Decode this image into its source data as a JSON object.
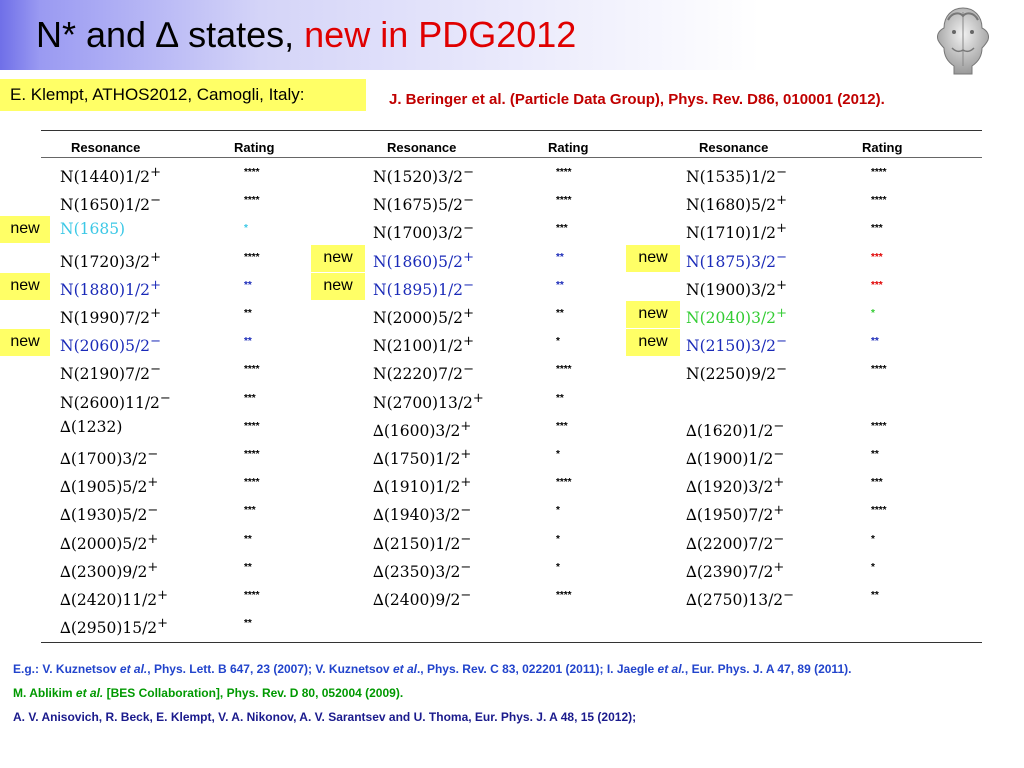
{
  "header": {
    "title_main": "N* and ∆ states, ",
    "title_highlight": "new in PDG2012"
  },
  "author_box": "E. Klempt, ATHOS2012, Camogli, Italy:",
  "top_reference": "J. Beringer et al. (Particle Data Group), Phys. Rev. D86, 010001 (2012).",
  "table": {
    "headers": {
      "resonance": "Resonance",
      "rating": "Rating"
    },
    "new_label": "new",
    "columns": [
      [
        {
          "base": "N(1440)1/2",
          "parity": "+",
          "rating": "****",
          "color": "black",
          "new": false
        },
        {
          "base": "N(1650)1/2",
          "parity": "−",
          "rating": "****",
          "color": "black",
          "new": false
        },
        {
          "base": "N(1685)",
          "parity": "",
          "rating": "*",
          "color": "cyan",
          "new": true
        },
        {
          "base": "N(1720)3/2",
          "parity": "+",
          "rating": "****",
          "color": "black",
          "new": false
        },
        {
          "base": "N(1880)1/2",
          "parity": "+",
          "rating": "**",
          "color": "blue",
          "new": true
        },
        {
          "base": "N(1990)7/2",
          "parity": "+",
          "rating": "**",
          "color": "black",
          "new": false
        },
        {
          "base": "N(2060)5/2",
          "parity": "−",
          "rating": "**",
          "color": "blue",
          "new": true
        },
        {
          "base": "N(2190)7/2",
          "parity": "−",
          "rating": "****",
          "color": "black",
          "new": false
        },
        {
          "base": "N(2600)11/2",
          "parity": "−",
          "rating": "***",
          "color": "black",
          "new": false
        },
        {
          "base": "∆(1232)",
          "parity": "",
          "rating": "****",
          "color": "black",
          "new": false
        },
        {
          "base": "∆(1700)3/2",
          "parity": "−",
          "rating": "****",
          "color": "black",
          "new": false
        },
        {
          "base": "∆(1905)5/2",
          "parity": "+",
          "rating": "****",
          "color": "black",
          "new": false
        },
        {
          "base": "∆(1930)5/2",
          "parity": "−",
          "rating": "***",
          "color": "black",
          "new": false
        },
        {
          "base": "∆(2000)5/2",
          "parity": "+",
          "rating": "**",
          "color": "black",
          "new": false
        },
        {
          "base": "∆(2300)9/2",
          "parity": "+",
          "rating": "**",
          "color": "black",
          "new": false
        },
        {
          "base": "∆(2420)11/2",
          "parity": "+",
          "rating": "****",
          "color": "black",
          "new": false
        },
        {
          "base": "∆(2950)15/2",
          "parity": "+",
          "rating": "**",
          "color": "black",
          "new": false
        }
      ],
      [
        {
          "base": "N(1520)3/2",
          "parity": "−",
          "rating": "****",
          "color": "black",
          "new": false
        },
        {
          "base": "N(1675)5/2",
          "parity": "−",
          "rating": "****",
          "color": "black",
          "new": false
        },
        {
          "base": "N(1700)3/2",
          "parity": "−",
          "rating": "***",
          "color": "black",
          "new": false
        },
        {
          "base": "N(1860)5/2",
          "parity": "+",
          "rating": "**",
          "color": "blue",
          "new": true
        },
        {
          "base": "N(1895)1/2",
          "parity": "−",
          "rating": "**",
          "color": "blue",
          "new": true
        },
        {
          "base": "N(2000)5/2",
          "parity": "+",
          "rating": "**",
          "color": "black",
          "new": false
        },
        {
          "base": "N(2100)1/2",
          "parity": "+",
          "rating": "*",
          "color": "black",
          "new": false
        },
        {
          "base": "N(2220)7/2",
          "parity": "−",
          "rating": "****",
          "color": "black",
          "new": false
        },
        {
          "base": "N(2700)13/2",
          "parity": "+",
          "rating": "**",
          "color": "black",
          "new": false
        },
        {
          "base": "∆(1600)3/2",
          "parity": "+",
          "rating": "***",
          "color": "black",
          "new": false
        },
        {
          "base": "∆(1750)1/2",
          "parity": "+",
          "rating": "*",
          "color": "black",
          "new": false
        },
        {
          "base": "∆(1910)1/2",
          "parity": "+",
          "rating": "****",
          "color": "black",
          "new": false
        },
        {
          "base": "∆(1940)3/2",
          "parity": "−",
          "rating": "*",
          "color": "black",
          "new": false
        },
        {
          "base": "∆(2150)1/2",
          "parity": "−",
          "rating": "*",
          "color": "black",
          "new": false
        },
        {
          "base": "∆(2350)3/2",
          "parity": "−",
          "rating": "*",
          "color": "black",
          "new": false
        },
        {
          "base": "∆(2400)9/2",
          "parity": "−",
          "rating": "****",
          "color": "black",
          "new": false
        }
      ],
      [
        {
          "base": "N(1535)1/2",
          "parity": "−",
          "rating": "****",
          "color": "black",
          "new": false
        },
        {
          "base": "N(1680)5/2",
          "parity": "+",
          "rating": "****",
          "color": "black",
          "new": false
        },
        {
          "base": "N(1710)1/2",
          "parity": "+",
          "rating": "***",
          "color": "black",
          "new": false
        },
        {
          "base": "N(1875)3/2",
          "parity": "−",
          "rating": "***",
          "color": "blue",
          "rating_color": "red",
          "new": true
        },
        {
          "base": "N(1900)3/2",
          "parity": "+",
          "rating": "***",
          "color": "black",
          "rating_color": "red",
          "new": false
        },
        {
          "base": "N(2040)3/2",
          "parity": "+",
          "rating": "*",
          "color": "green",
          "new": true
        },
        {
          "base": "N(2150)3/2",
          "parity": "−",
          "rating": "**",
          "color": "blue",
          "new": true
        },
        {
          "base": "N(2250)9/2",
          "parity": "−",
          "rating": "****",
          "color": "black",
          "new": false
        },
        null,
        {
          "base": "∆(1620)1/2",
          "parity": "−",
          "rating": "****",
          "color": "black",
          "new": false
        },
        {
          "base": "∆(1900)1/2",
          "parity": "−",
          "rating": "**",
          "color": "black",
          "new": false
        },
        {
          "base": "∆(1920)3/2",
          "parity": "+",
          "rating": "***",
          "color": "black",
          "new": false
        },
        {
          "base": "∆(1950)7/2",
          "parity": "+",
          "rating": "****",
          "color": "black",
          "new": false
        },
        {
          "base": "∆(2200)7/2",
          "parity": "−",
          "rating": "*",
          "color": "black",
          "new": false
        },
        {
          "base": "∆(2390)7/2",
          "parity": "+",
          "rating": "*",
          "color": "black",
          "new": false
        },
        {
          "base": "∆(2750)13/2",
          "parity": "−",
          "rating": "**",
          "color": "black",
          "new": false
        }
      ]
    ]
  },
  "references": {
    "line1": [
      {
        "text": "E.g.: V. Kuznetsov ",
        "italic": false
      },
      {
        "text": "et al.",
        "italic": true
      },
      {
        "text": ", Phys. Lett. B 647, 23 (2007); V. Kuznetsov ",
        "italic": false
      },
      {
        "text": "et al",
        "italic": true
      },
      {
        "text": "., Phys. Rev. C 83, 022201 (2011); I. Jaegle ",
        "italic": false
      },
      {
        "text": "et al.",
        "italic": true
      },
      {
        "text": ", Eur. Phys. J. A 47, 89 (2011).",
        "italic": false
      }
    ],
    "line2": [
      {
        "text": "M. Ablikim ",
        "italic": false
      },
      {
        "text": "et al.",
        "italic": true
      },
      {
        "text": " [BES Collaboration], Phys. Rev. D 80, 052004 (2009).",
        "italic": false
      }
    ],
    "line3": "A. V. Anisovich, R. Beck, E. Klempt, V. A. Nikonov, A. V. Sarantsev and U. Thoma, Eur. Phys. J. A 48, 15 (2012);"
  },
  "colors": {
    "title_highlight": "#e00000",
    "highlight_box": "#ffff66",
    "cyan": "#3cc8e6",
    "blue": "#1a2ab8",
    "green": "#33cc33",
    "red": "#e00000",
    "ref_line1": "#2244cc",
    "ref_line2": "#009900",
    "ref_line3": "#1a1a8c"
  },
  "logo_icon": "janus-head-icon"
}
